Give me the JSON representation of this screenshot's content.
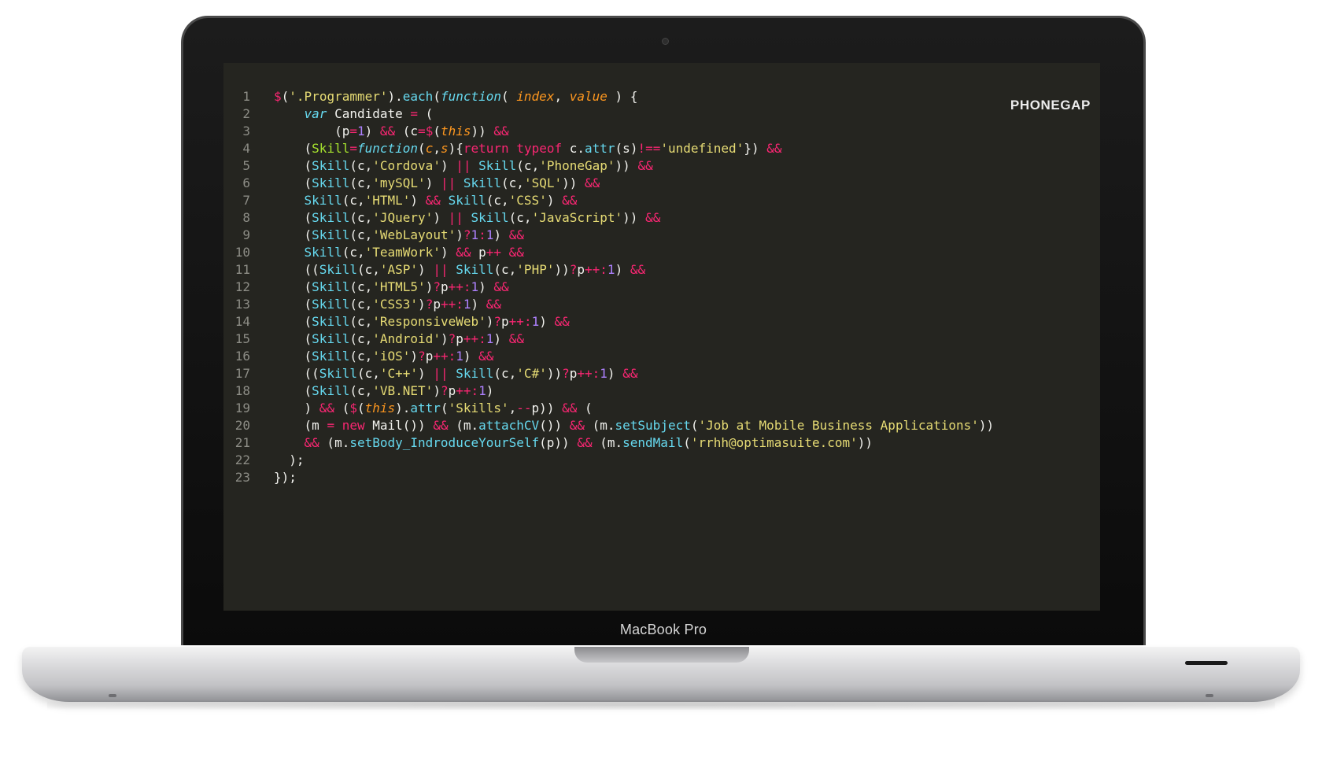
{
  "device": {
    "brand_label": "MacBook Pro"
  },
  "screen": {
    "corner_label": "PHONEGAP",
    "background": "#252520"
  },
  "colors": {
    "keyword": "#f92672",
    "green": "#a6e22e",
    "string": "#e6db74",
    "number": "#ae81ff",
    "method": "#66d9ef",
    "param": "#fd971f",
    "text": "#f2f2ee",
    "line_number": "#8d8d86"
  },
  "code_lines": [
    {
      "n": "1",
      "tokens": [
        [
          "k",
          "$"
        ],
        [
          "w",
          "("
        ],
        [
          "s",
          "'.Programmer'"
        ],
        [
          "w",
          ")."
        ],
        [
          "m",
          "each"
        ],
        [
          "w",
          "("
        ],
        [
          "mi",
          "function"
        ],
        [
          "w",
          "( "
        ],
        [
          "p",
          "index"
        ],
        [
          "w",
          ", "
        ],
        [
          "p",
          "value"
        ],
        [
          "w",
          " ) {"
        ]
      ]
    },
    {
      "n": "2",
      "tokens": [
        [
          "w",
          "    "
        ],
        [
          "mi",
          "var"
        ],
        [
          "w",
          " Candidate "
        ],
        [
          "k",
          "="
        ],
        [
          "w",
          " ("
        ]
      ]
    },
    {
      "n": "3",
      "tokens": [
        [
          "w",
          "        (p"
        ],
        [
          "k",
          "="
        ],
        [
          "n",
          "1"
        ],
        [
          "w",
          ") "
        ],
        [
          "k",
          "&&"
        ],
        [
          "w",
          " (c"
        ],
        [
          "k",
          "="
        ],
        [
          "k",
          "$"
        ],
        [
          "w",
          "("
        ],
        [
          "p",
          "this"
        ],
        [
          "w",
          "))"
        ],
        [
          "w",
          " "
        ],
        [
          "k",
          "&&"
        ]
      ]
    },
    {
      "n": "4",
      "tokens": [
        [
          "w",
          "    ("
        ],
        [
          "f",
          "Skill"
        ],
        [
          "k",
          "="
        ],
        [
          "mi",
          "function"
        ],
        [
          "w",
          "("
        ],
        [
          "p",
          "c"
        ],
        [
          "w",
          ","
        ],
        [
          "p",
          "s"
        ],
        [
          "w",
          "){"
        ],
        [
          "k",
          "return"
        ],
        [
          "w",
          " "
        ],
        [
          "k",
          "typeof"
        ],
        [
          "w",
          " c."
        ],
        [
          "m",
          "attr"
        ],
        [
          "w",
          "(s)"
        ],
        [
          "k",
          "!=="
        ],
        [
          "s",
          "'undefined'"
        ],
        [
          "w",
          "}) "
        ],
        [
          "k",
          "&&"
        ]
      ]
    },
    {
      "n": "5",
      "tokens": [
        [
          "w",
          "    ("
        ],
        [
          "m",
          "Skill"
        ],
        [
          "w",
          "(c,"
        ],
        [
          "s",
          "'Cordova'"
        ],
        [
          "w",
          ") "
        ],
        [
          "k",
          "||"
        ],
        [
          "w",
          " "
        ],
        [
          "m",
          "Skill"
        ],
        [
          "w",
          "(c,"
        ],
        [
          "s",
          "'PhoneGap'"
        ],
        [
          "w",
          ")) "
        ],
        [
          "k",
          "&&"
        ]
      ]
    },
    {
      "n": "6",
      "tokens": [
        [
          "w",
          "    ("
        ],
        [
          "m",
          "Skill"
        ],
        [
          "w",
          "(c,"
        ],
        [
          "s",
          "'mySQL'"
        ],
        [
          "w",
          ") "
        ],
        [
          "k",
          "||"
        ],
        [
          "w",
          " "
        ],
        [
          "m",
          "Skill"
        ],
        [
          "w",
          "(c,"
        ],
        [
          "s",
          "'SQL'"
        ],
        [
          "w",
          ")) "
        ],
        [
          "k",
          "&&"
        ]
      ]
    },
    {
      "n": "7",
      "tokens": [
        [
          "w",
          "    "
        ],
        [
          "m",
          "Skill"
        ],
        [
          "w",
          "(c,"
        ],
        [
          "s",
          "'HTML'"
        ],
        [
          "w",
          ") "
        ],
        [
          "k",
          "&&"
        ],
        [
          "w",
          " "
        ],
        [
          "m",
          "Skill"
        ],
        [
          "w",
          "(c,"
        ],
        [
          "s",
          "'CSS'"
        ],
        [
          "w",
          ") "
        ],
        [
          "k",
          "&&"
        ]
      ]
    },
    {
      "n": "8",
      "tokens": [
        [
          "w",
          "    ("
        ],
        [
          "m",
          "Skill"
        ],
        [
          "w",
          "(c,"
        ],
        [
          "s",
          "'JQuery'"
        ],
        [
          "w",
          ") "
        ],
        [
          "k",
          "||"
        ],
        [
          "w",
          " "
        ],
        [
          "m",
          "Skill"
        ],
        [
          "w",
          "(c,"
        ],
        [
          "s",
          "'JavaScript'"
        ],
        [
          "w",
          ")) "
        ],
        [
          "k",
          "&&"
        ]
      ]
    },
    {
      "n": "9",
      "tokens": [
        [
          "w",
          "    ("
        ],
        [
          "m",
          "Skill"
        ],
        [
          "w",
          "(c,"
        ],
        [
          "s",
          "'WebLayout'"
        ],
        [
          "w",
          ")"
        ],
        [
          "k",
          "?"
        ],
        [
          "n",
          "1"
        ],
        [
          "k",
          ":"
        ],
        [
          "n",
          "1"
        ],
        [
          "w",
          ") "
        ],
        [
          "k",
          "&&"
        ]
      ]
    },
    {
      "n": "10",
      "tokens": [
        [
          "w",
          "    "
        ],
        [
          "m",
          "Skill"
        ],
        [
          "w",
          "(c,"
        ],
        [
          "s",
          "'TeamWork'"
        ],
        [
          "w",
          ") "
        ],
        [
          "k",
          "&&"
        ],
        [
          "w",
          " p"
        ],
        [
          "k",
          "++"
        ],
        [
          "w",
          " "
        ],
        [
          "k",
          "&&"
        ]
      ]
    },
    {
      "n": "11",
      "tokens": [
        [
          "w",
          "    (("
        ],
        [
          "m",
          "Skill"
        ],
        [
          "w",
          "(c,"
        ],
        [
          "s",
          "'ASP'"
        ],
        [
          "w",
          ") "
        ],
        [
          "k",
          "||"
        ],
        [
          "w",
          " "
        ],
        [
          "m",
          "Skill"
        ],
        [
          "w",
          "(c,"
        ],
        [
          "s",
          "'PHP'"
        ],
        [
          "w",
          "))"
        ],
        [
          "k",
          "?"
        ],
        [
          "w",
          "p"
        ],
        [
          "k",
          "++"
        ],
        [
          "k",
          ":"
        ],
        [
          "n",
          "1"
        ],
        [
          "w",
          ") "
        ],
        [
          "k",
          "&&"
        ]
      ]
    },
    {
      "n": "12",
      "tokens": [
        [
          "w",
          "    ("
        ],
        [
          "m",
          "Skill"
        ],
        [
          "w",
          "(c,"
        ],
        [
          "s",
          "'HTML5'"
        ],
        [
          "w",
          ")"
        ],
        [
          "k",
          "?"
        ],
        [
          "w",
          "p"
        ],
        [
          "k",
          "++"
        ],
        [
          "k",
          ":"
        ],
        [
          "n",
          "1"
        ],
        [
          "w",
          ") "
        ],
        [
          "k",
          "&&"
        ]
      ]
    },
    {
      "n": "13",
      "tokens": [
        [
          "w",
          "    ("
        ],
        [
          "m",
          "Skill"
        ],
        [
          "w",
          "(c,"
        ],
        [
          "s",
          "'CSS3'"
        ],
        [
          "w",
          ")"
        ],
        [
          "k",
          "?"
        ],
        [
          "w",
          "p"
        ],
        [
          "k",
          "++"
        ],
        [
          "k",
          ":"
        ],
        [
          "n",
          "1"
        ],
        [
          "w",
          ") "
        ],
        [
          "k",
          "&&"
        ]
      ]
    },
    {
      "n": "14",
      "tokens": [
        [
          "w",
          "    ("
        ],
        [
          "m",
          "Skill"
        ],
        [
          "w",
          "(c,"
        ],
        [
          "s",
          "'ResponsiveWeb'"
        ],
        [
          "w",
          ")"
        ],
        [
          "k",
          "?"
        ],
        [
          "w",
          "p"
        ],
        [
          "k",
          "++"
        ],
        [
          "k",
          ":"
        ],
        [
          "n",
          "1"
        ],
        [
          "w",
          ") "
        ],
        [
          "k",
          "&&"
        ]
      ]
    },
    {
      "n": "15",
      "tokens": [
        [
          "w",
          "    ("
        ],
        [
          "m",
          "Skill"
        ],
        [
          "w",
          "(c,"
        ],
        [
          "s",
          "'Android'"
        ],
        [
          "w",
          ")"
        ],
        [
          "k",
          "?"
        ],
        [
          "w",
          "p"
        ],
        [
          "k",
          "++"
        ],
        [
          "k",
          ":"
        ],
        [
          "n",
          "1"
        ],
        [
          "w",
          ") "
        ],
        [
          "k",
          "&&"
        ]
      ]
    },
    {
      "n": "16",
      "tokens": [
        [
          "w",
          "    ("
        ],
        [
          "m",
          "Skill"
        ],
        [
          "w",
          "(c,"
        ],
        [
          "s",
          "'iOS'"
        ],
        [
          "w",
          ")"
        ],
        [
          "k",
          "?"
        ],
        [
          "w",
          "p"
        ],
        [
          "k",
          "++"
        ],
        [
          "k",
          ":"
        ],
        [
          "n",
          "1"
        ],
        [
          "w",
          ") "
        ],
        [
          "k",
          "&&"
        ]
      ]
    },
    {
      "n": "17",
      "tokens": [
        [
          "w",
          "    (("
        ],
        [
          "m",
          "Skill"
        ],
        [
          "w",
          "(c,"
        ],
        [
          "s",
          "'C++'"
        ],
        [
          "w",
          ") "
        ],
        [
          "k",
          "||"
        ],
        [
          "w",
          " "
        ],
        [
          "m",
          "Skill"
        ],
        [
          "w",
          "(c,"
        ],
        [
          "s",
          "'C#'"
        ],
        [
          "w",
          "))"
        ],
        [
          "k",
          "?"
        ],
        [
          "w",
          "p"
        ],
        [
          "k",
          "++"
        ],
        [
          "k",
          ":"
        ],
        [
          "n",
          "1"
        ],
        [
          "w",
          ") "
        ],
        [
          "k",
          "&&"
        ]
      ]
    },
    {
      "n": "18",
      "tokens": [
        [
          "w",
          "    ("
        ],
        [
          "m",
          "Skill"
        ],
        [
          "w",
          "(c,"
        ],
        [
          "s",
          "'VB.NET'"
        ],
        [
          "w",
          ")"
        ],
        [
          "k",
          "?"
        ],
        [
          "w",
          "p"
        ],
        [
          "k",
          "++"
        ],
        [
          "k",
          ":"
        ],
        [
          "n",
          "1"
        ],
        [
          "w",
          ")"
        ]
      ]
    },
    {
      "n": "19",
      "tokens": [
        [
          "w",
          "    ) "
        ],
        [
          "k",
          "&&"
        ],
        [
          "w",
          " ("
        ],
        [
          "k",
          "$"
        ],
        [
          "w",
          "("
        ],
        [
          "p",
          "this"
        ],
        [
          "w",
          ")."
        ],
        [
          "m",
          "attr"
        ],
        [
          "w",
          "("
        ],
        [
          "s",
          "'Skills'"
        ],
        [
          "w",
          ","
        ],
        [
          "k",
          "--"
        ],
        [
          "w",
          "p)) "
        ],
        [
          "k",
          "&&"
        ],
        [
          "w",
          " ("
        ]
      ]
    },
    {
      "n": "20",
      "tokens": [
        [
          "w",
          "    (m "
        ],
        [
          "k",
          "="
        ],
        [
          "w",
          " "
        ],
        [
          "k",
          "new"
        ],
        [
          "w",
          " Mail()) "
        ],
        [
          "k",
          "&&"
        ],
        [
          "w",
          " (m."
        ],
        [
          "m",
          "attachCV"
        ],
        [
          "w",
          "()) "
        ],
        [
          "k",
          "&&"
        ],
        [
          "w",
          " (m."
        ],
        [
          "m",
          "setSubject"
        ],
        [
          "w",
          "("
        ],
        [
          "s",
          "'Job at Mobile Business Applications'"
        ],
        [
          "w",
          "))"
        ]
      ]
    },
    {
      "n": "21",
      "tokens": [
        [
          "w",
          "    "
        ],
        [
          "k",
          "&&"
        ],
        [
          "w",
          " (m."
        ],
        [
          "m",
          "setBody_IndroduceYourSelf"
        ],
        [
          "w",
          "(p)) "
        ],
        [
          "k",
          "&&"
        ],
        [
          "w",
          " (m."
        ],
        [
          "m",
          "sendMail"
        ],
        [
          "w",
          "("
        ],
        [
          "s",
          "'rrhh@optimasuite.com'"
        ],
        [
          "w",
          "))"
        ]
      ]
    },
    {
      "n": "22",
      "tokens": [
        [
          "w",
          "  );"
        ]
      ]
    },
    {
      "n": "23",
      "tokens": [
        [
          "w",
          "});"
        ]
      ]
    }
  ]
}
